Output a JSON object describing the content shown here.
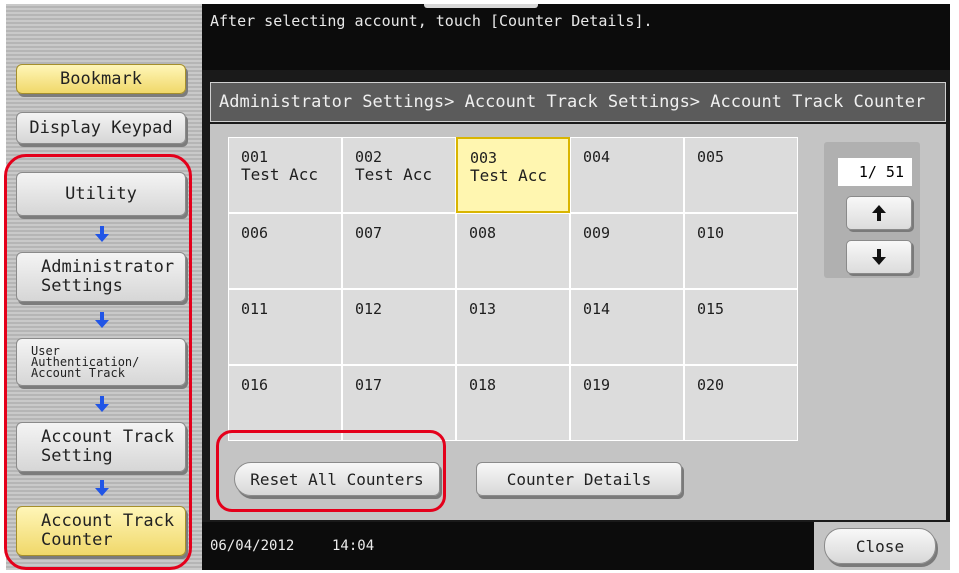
{
  "message": "After selecting account, touch [Counter Details].",
  "left_nav": {
    "bookmark": "Bookmark",
    "display_keypad": "Display Keypad",
    "utility": "Utility",
    "administrator_settings": "Administrator\nSettings",
    "user_auth": "User\nAuthentication/\nAccount Track",
    "account_track_setting": "Account Track\nSetting",
    "account_track_counter": "Account Track\nCounter"
  },
  "breadcrumb": "Administrator Settings> Account Track Settings> Account Track Counter",
  "accounts": [
    {
      "num": "001",
      "name": "Test Acc"
    },
    {
      "num": "002",
      "name": "Test Acc"
    },
    {
      "num": "003",
      "name": "Test Acc",
      "selected": true
    },
    {
      "num": "004",
      "name": ""
    },
    {
      "num": "005",
      "name": ""
    },
    {
      "num": "006",
      "name": ""
    },
    {
      "num": "007",
      "name": ""
    },
    {
      "num": "008",
      "name": ""
    },
    {
      "num": "009",
      "name": ""
    },
    {
      "num": "010",
      "name": ""
    },
    {
      "num": "011",
      "name": ""
    },
    {
      "num": "012",
      "name": ""
    },
    {
      "num": "013",
      "name": ""
    },
    {
      "num": "014",
      "name": ""
    },
    {
      "num": "015",
      "name": ""
    },
    {
      "num": "016",
      "name": ""
    },
    {
      "num": "017",
      "name": ""
    },
    {
      "num": "018",
      "name": ""
    },
    {
      "num": "019",
      "name": ""
    },
    {
      "num": "020",
      "name": ""
    }
  ],
  "pager": {
    "label": "1/ 51",
    "up_icon": "arrow-up-icon",
    "down_icon": "arrow-down-icon"
  },
  "buttons": {
    "reset_all": "Reset All Counters",
    "counter_details": "Counter Details",
    "close": "Close"
  },
  "status": {
    "date": "06/04/2012",
    "time": "14:04"
  },
  "colors": {
    "highlight_red": "#e4001b",
    "selected_yellow": "#fff6b0",
    "nav_yellow": "#f0d86a",
    "nav_arrow_blue": "#2155e6"
  }
}
